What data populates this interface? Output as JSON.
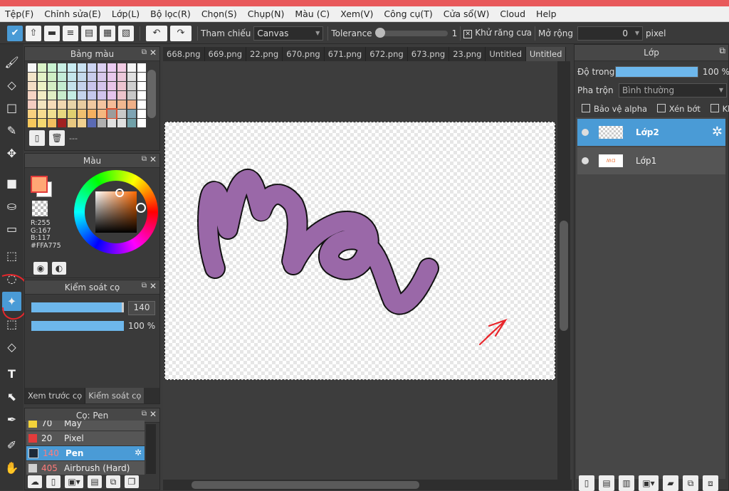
{
  "menu": [
    "Tệp(F)",
    "Chỉnh sửa(E)",
    "Lớp(L)",
    "Bộ lọc(R)",
    "Chọn(S)",
    "Chụp(N)",
    "Màu (C)",
    "Xem(V)",
    "Công cụ(T)",
    "Cửa sổ(W)",
    "Cloud",
    "Help"
  ],
  "toolbar": {
    "reference_label": "Tham chiếu",
    "reference_value": "Canvas",
    "tolerance_label": "Tolerance",
    "tolerance_value": "1",
    "antialias_label": "Khử răng cưa",
    "expand_label": "Mở rộng",
    "expand_value": "0",
    "expand_unit": "pixel"
  },
  "palette_panel": {
    "title": "Bảng màu",
    "footer_text": "---"
  },
  "color_panel": {
    "title": "Màu",
    "r": "R:255",
    "g": "G:167",
    "b": "B:117",
    "hex": "#FFA775",
    "fg_color": "#ffa775"
  },
  "brush_control": {
    "title": "Kiểm soát cọ",
    "size_value": "140",
    "opacity_value": "100 %"
  },
  "bottom_tabs": [
    "Xem trước cọ",
    "Kiểm soát cọ"
  ],
  "brush_panel": {
    "title": "Cọ: Pen",
    "items": [
      {
        "size": "70",
        "name": "Mây",
        "color": "#f2d23a"
      },
      {
        "size": "20",
        "name": "Pixel",
        "color": "#e23b3b"
      },
      {
        "size": "140",
        "name": "Pen",
        "color": "#1d2a3a"
      },
      {
        "size": "405",
        "name": "Airbrush (Hard)",
        "color": "#cfcfcf"
      }
    ]
  },
  "tabs": [
    "668.png",
    "669.png",
    "22.png",
    "670.png",
    "671.png",
    "672.png",
    "673.png",
    "23.png",
    "Untitled",
    "Untitled"
  ],
  "layers_panel": {
    "title": "Lớp",
    "opacity_label": "Độ trong",
    "opacity_value": "100 %",
    "blend_label": "Pha trộn",
    "blend_value": "Bình thường",
    "protect_alpha": "Bảo vệ alpha",
    "clip": "Xén bớt",
    "lock": "Khóa",
    "layers": [
      {
        "name": "Lớp2",
        "selected": true
      },
      {
        "name": "Lớp1",
        "selected": false
      }
    ]
  },
  "colors": {
    "accent": "#4a9bd6",
    "stroke": "#9a68a8",
    "annotation": "#e8262b"
  }
}
